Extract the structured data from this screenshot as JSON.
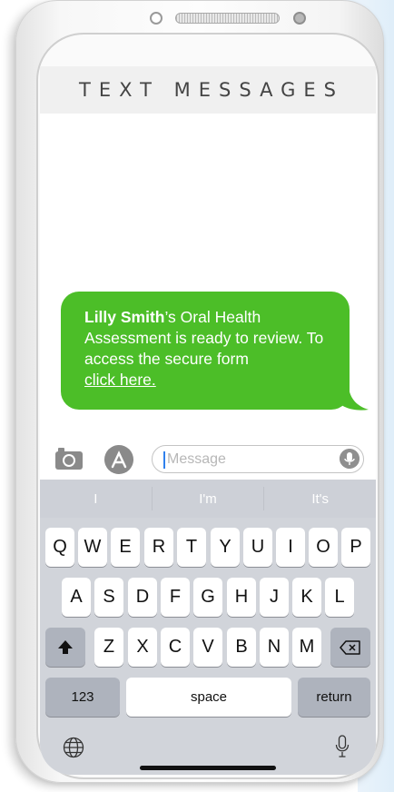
{
  "header": {
    "title": "TEXT MESSAGES"
  },
  "message": {
    "name": "Lilly Smith",
    "text_after_name": "’s Oral Health Assessment is ready to review. To access the secure form",
    "link_label": "click here."
  },
  "composer": {
    "placeholder": "Message"
  },
  "suggestions": [
    "I",
    "I'm",
    "It's"
  ],
  "keyboard": {
    "row1": [
      "Q",
      "W",
      "E",
      "R",
      "T",
      "Y",
      "U",
      "I",
      "O",
      "P"
    ],
    "row2": [
      "A",
      "S",
      "D",
      "F",
      "G",
      "H",
      "J",
      "K",
      "L"
    ],
    "row3": [
      "Z",
      "X",
      "C",
      "V",
      "B",
      "N",
      "M"
    ],
    "numbers_label": "123",
    "space_label": "space",
    "return_label": "return",
    "icons": {
      "shift": "shift-icon",
      "backspace": "backspace-icon",
      "globe": "globe-icon",
      "dictation": "microphone-icon",
      "camera": "camera-icon",
      "apps": "app-store-icon"
    }
  },
  "colors": {
    "bubble": "#4cbe28",
    "header_bg": "#f0f0f0",
    "keyboard_bg": "#d1d4da"
  }
}
